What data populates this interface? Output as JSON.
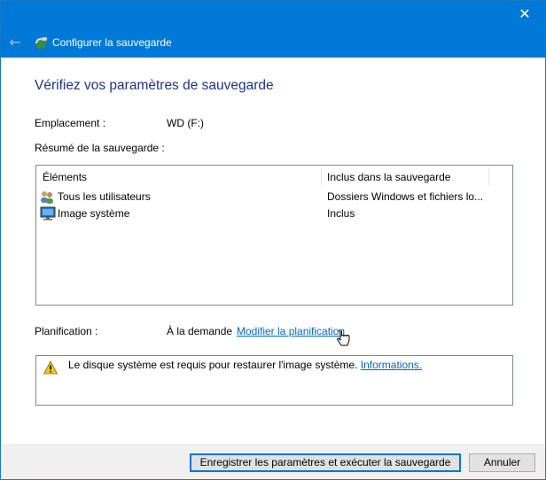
{
  "window": {
    "close_glyph": "✕",
    "back_glyph": "←",
    "title": "Configurer la sauvegarde"
  },
  "page": {
    "heading": "Vérifiez vos paramètres de sauvegarde",
    "location_label": "Emplacement :",
    "location_value": "WD (F:)",
    "summary_label": "Résumé de la sauvegarde :",
    "schedule_label": "Planification :",
    "schedule_value": "À la demande",
    "schedule_link": "Modifier la planification"
  },
  "summary_table": {
    "columns": [
      "Éléments",
      "Inclus dans la sauvegarde"
    ],
    "rows": [
      {
        "item": "Tous les utilisateurs",
        "included": "Dossiers Windows et fichiers lo...",
        "icon": "users-icon"
      },
      {
        "item": "Image système",
        "included": "Inclus",
        "icon": "monitor-icon"
      }
    ]
  },
  "warning": {
    "text": "Le disque système est requis pour restaurer l'image système.",
    "link": "Informations."
  },
  "buttons": {
    "save_run": "Enregistrer les paramètres et exécuter la sauvegarde",
    "cancel": "Annuler"
  },
  "colors": {
    "titlebar": "#0078d7",
    "heading": "#1e3287",
    "link": "#0066cc"
  }
}
